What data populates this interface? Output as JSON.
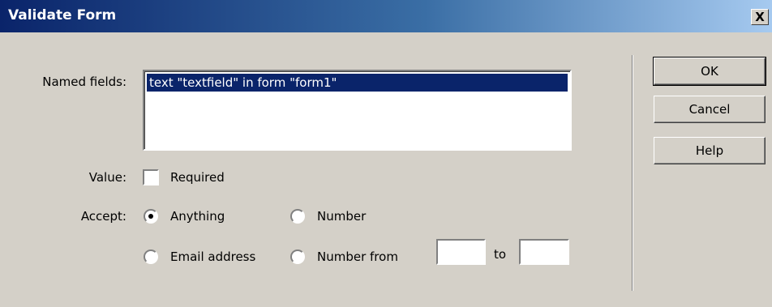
{
  "window": {
    "title": "Validate Form",
    "close_label": "X"
  },
  "named_fields": {
    "label": "Named fields:",
    "items": [
      "text \"textfield\" in form \"form1\""
    ]
  },
  "value": {
    "label": "Value:",
    "required_label": "Required",
    "required_checked": false
  },
  "accept": {
    "label": "Accept:",
    "anything": "Anything",
    "number": "Number",
    "email": "Email address",
    "number_from": "Number from",
    "to": "to",
    "selected": "Anything",
    "from_value": "",
    "to_value": ""
  },
  "buttons": {
    "ok": "OK",
    "cancel": "Cancel",
    "help": "Help"
  }
}
